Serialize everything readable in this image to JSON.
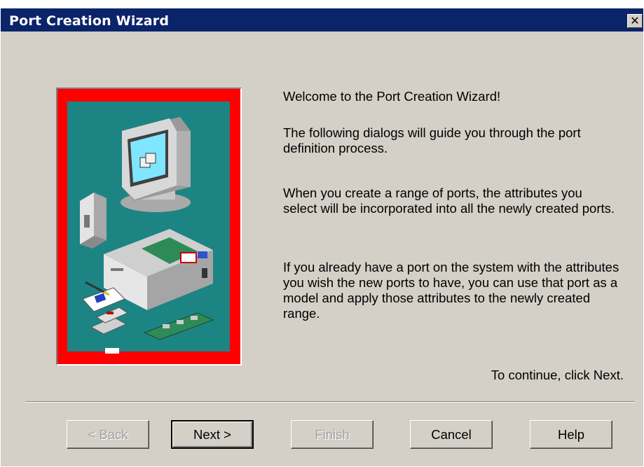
{
  "window": {
    "title": "Port Creation Wizard",
    "close_symbol": "✕"
  },
  "content": {
    "welcome": "Welcome to the Port Creation Wizard!",
    "paragraph1": "The following dialogs will guide you through the port definition process.",
    "paragraph2": "When you create a range of ports, the attributes you select will be incorporated into all the newly created ports.",
    "paragraph3": "If you already have a port on the system with the attributes you wish the new ports to have, you can use that port as a model and apply those attributes to the newly created range.",
    "continue_hint": "To continue, click Next."
  },
  "buttons": {
    "back": "< Back",
    "next": "Next >",
    "finish": "Finish",
    "cancel": "Cancel",
    "help": "Help"
  },
  "colors": {
    "titlebar": "#0a246a",
    "dialog_bg": "#d4d0c8",
    "illustration_frame": "#ff0000",
    "illustration_bg": "#1d8484"
  },
  "illustration": {
    "icons": [
      "computer-monitor-icon",
      "modem-icon",
      "system-unit-icon",
      "notepad-icon",
      "disks-icon",
      "expansion-card-icon"
    ]
  }
}
